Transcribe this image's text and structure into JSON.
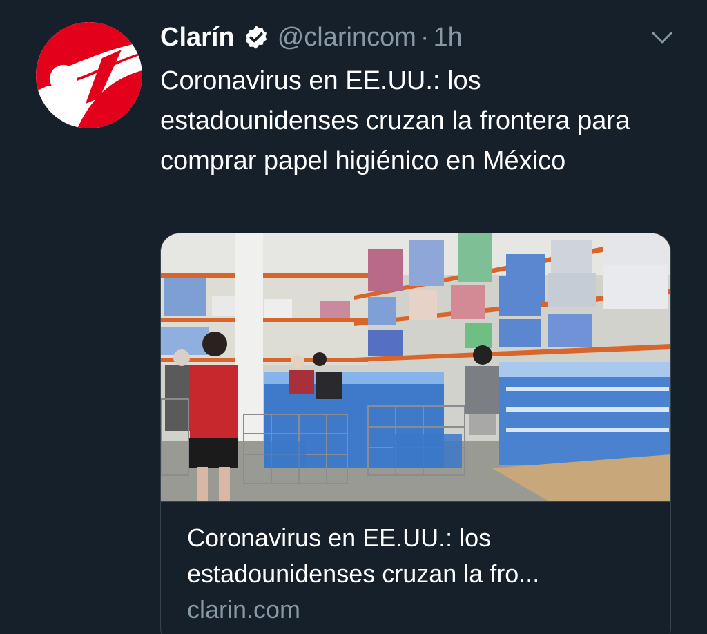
{
  "account": {
    "display_name": "Clarín",
    "handle": "@clarincom",
    "separator": "·",
    "time": "1h",
    "verified": true,
    "avatar_icon": "clarin-logo-icon",
    "avatar_colors": {
      "background": "#e3001b",
      "mark": "#ffffff"
    }
  },
  "tweet": {
    "text": "Coronavirus en EE.UU.: los estadounidenses cruzan la frontera para comprar papel higiénico en México"
  },
  "card": {
    "title_line1": "Coronavirus en EE.UU.: los",
    "title_line2": "estadounidenses cruzan la fro...",
    "domain": "clarin.com",
    "image_icon": "warehouse-photo"
  },
  "menu": {
    "icon": "chevron-down-icon"
  },
  "colors": {
    "background": "#15202b",
    "primary_text": "#ffffff",
    "secondary_text": "#8899a6",
    "border": "#38444d"
  }
}
